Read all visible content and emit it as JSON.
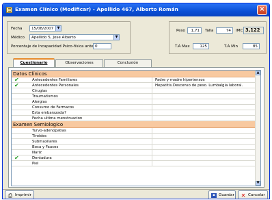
{
  "window": {
    "title": "Examen Clínico (Modificar) - Apellido 467, Alberto Román"
  },
  "header": {
    "fecha_label": "Fecha",
    "fecha_value": "15/08/2007",
    "medico_label": "Médico",
    "medico_value": "Apellido 5, Jose Alberto",
    "incapacidad_label": "Porcentaje de Incapacidad Psico-física anterior",
    "incapacidad_value": "0",
    "peso_label": "Peso",
    "peso_value": "1,71",
    "talla_label": "Talla",
    "talla_value": "74",
    "imc_label": "IMC",
    "imc_value": "3,122",
    "ta_max_label": "T.A Max",
    "ta_max_value": "125",
    "ta_min_label": "T.A Min",
    "ta_min_value": "85"
  },
  "tabs": [
    {
      "label": "Cuestionario",
      "active": true
    },
    {
      "label": "Observaciones",
      "active": false
    },
    {
      "label": "Conclusión",
      "active": false
    }
  ],
  "sections": [
    {
      "title": "Datos Clínicos",
      "rows": [
        {
          "name": "Antecedentes Familiares",
          "value": "Padre y madre hipertensos",
          "checked": true
        },
        {
          "name": "Antecedentes Personales",
          "value": "Hepatitis.Descenso de peso. Lumbalgia laboral.",
          "checked": true
        },
        {
          "name": "Cirugias",
          "value": "",
          "checked": false
        },
        {
          "name": "Traumatismos",
          "value": "",
          "checked": false
        },
        {
          "name": "Alergias",
          "value": "",
          "checked": false
        },
        {
          "name": "Consumo de Farmacos",
          "value": "",
          "checked": false
        },
        {
          "name": "Esta embarazada?",
          "value": "",
          "checked": false
        },
        {
          "name": "Fecha ultima menstruacion",
          "value": "",
          "checked": false
        }
      ]
    },
    {
      "title": "Examen Semiologico",
      "rows": [
        {
          "name": "Turvo-adenopatias",
          "value": "",
          "checked": false
        },
        {
          "name": "Tiroides",
          "value": "",
          "checked": false
        },
        {
          "name": "Submaxilares",
          "value": "",
          "checked": false
        },
        {
          "name": "Boca y Fauces",
          "value": "",
          "checked": false
        },
        {
          "name": "Nariz",
          "value": "",
          "checked": false
        },
        {
          "name": "Dentadura",
          "value": "",
          "checked": true
        },
        {
          "name": "Piel",
          "value": "",
          "checked": false
        }
      ]
    }
  ],
  "footer": {
    "imprimir_label": "Imprimir",
    "guardar_label": "Guardar",
    "cancelar_label": "Cancelar"
  },
  "icons": {
    "check": "checkmark-icon",
    "print": "printer-icon",
    "save": "floppy-disk-icon",
    "cancel": "red-x-icon"
  },
  "colors": {
    "title_bar": "#0a4fd6",
    "section_header": "#f8c9a0",
    "check": "#1f9a1f",
    "active_tab_accent": "#e68b2c",
    "cancel": "#d40000"
  }
}
